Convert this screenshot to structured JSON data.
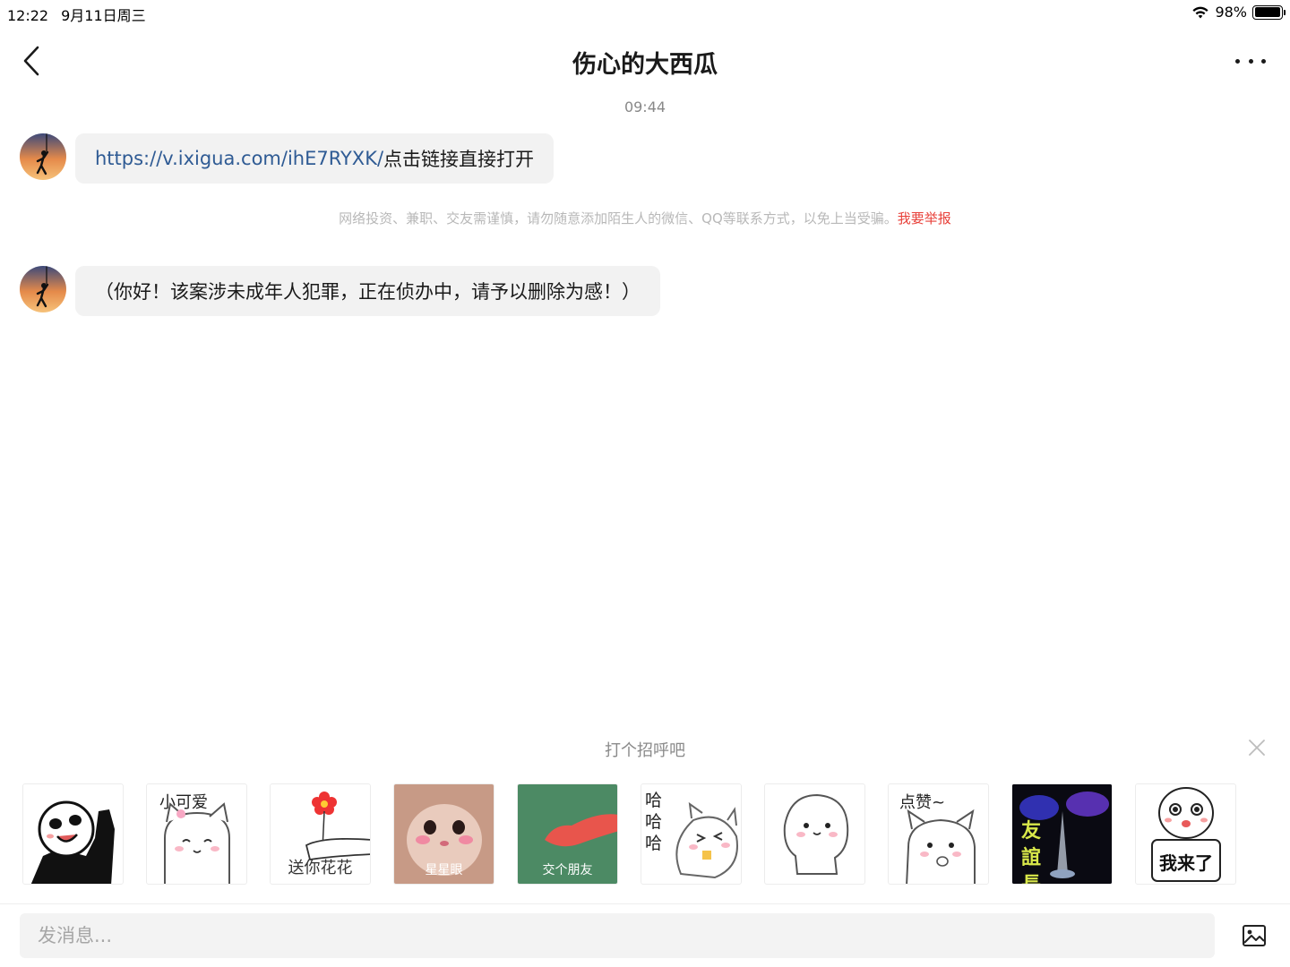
{
  "status_bar": {
    "time": "12:22",
    "date": "9月11日周三",
    "battery_text": "98%",
    "battery_level": 0.98
  },
  "header": {
    "title": "伤心的大西瓜"
  },
  "chat": {
    "timestamp": "09:44",
    "message1": {
      "link": "https://v.ixigua.com/ihE7RYXK/",
      "text": "点击链接直接打开"
    },
    "warning": {
      "text": "网络投资、兼职、交友需谨慎，请勿随意添加陌生人的微信、QQ等联系方式，以免上当受骗。",
      "report": "我要举报"
    },
    "message2": {
      "text": "（你好！该案涉未成年人犯罪，正在侦办中，请予以删除为感！）"
    }
  },
  "greeting": {
    "title": "打个招呼吧",
    "stickers": [
      {
        "caption": ""
      },
      {
        "caption": "小可爱"
      },
      {
        "caption": "送你花花"
      },
      {
        "caption": "星星眼"
      },
      {
        "caption": "交个朋友"
      },
      {
        "caption": "哈哈哈"
      },
      {
        "caption": ""
      },
      {
        "caption": "点赞~"
      },
      {
        "caption": "友誼長存"
      },
      {
        "caption": "我来了"
      }
    ]
  },
  "composer": {
    "placeholder": "发消息..."
  },
  "colors": {
    "link": "#2f5b94",
    "report": "#e8413a",
    "bubble": "#f2f2f2"
  }
}
